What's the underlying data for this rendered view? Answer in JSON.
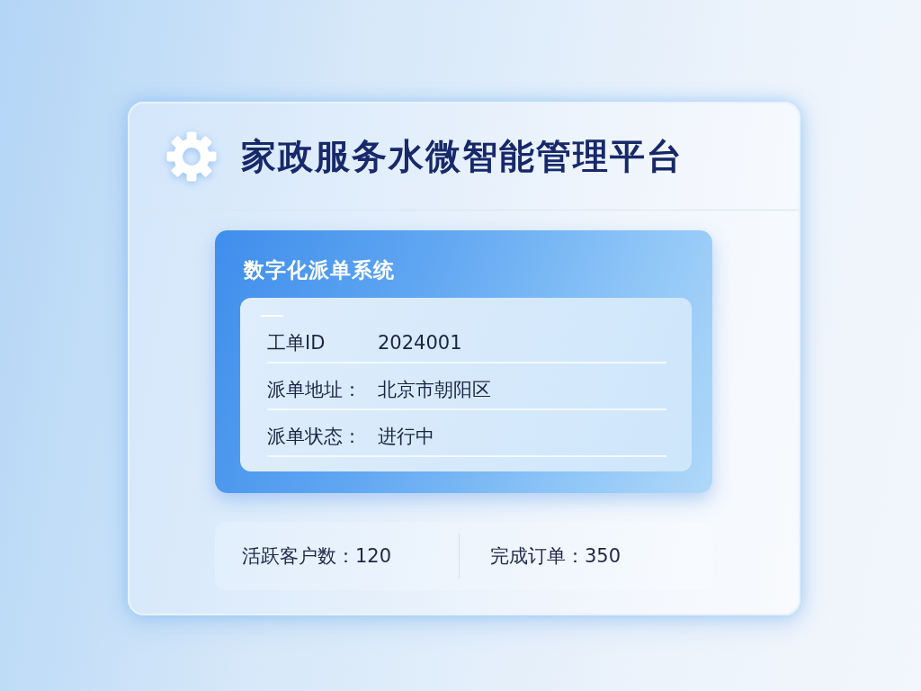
{
  "header": {
    "title": "家政服务水微智能管理平台"
  },
  "dispatch_card": {
    "title": "数字化派单系统",
    "fields": [
      {
        "label": "工单ID",
        "value": "2024001"
      },
      {
        "label": "派单地址：",
        "value": "北京市朝阳区"
      },
      {
        "label": "派单状态：",
        "value": "进行中"
      }
    ]
  },
  "stats": [
    {
      "label": "活跃客户数：",
      "value": "120"
    },
    {
      "label": "完成订单：",
      "value": "350"
    }
  ]
}
